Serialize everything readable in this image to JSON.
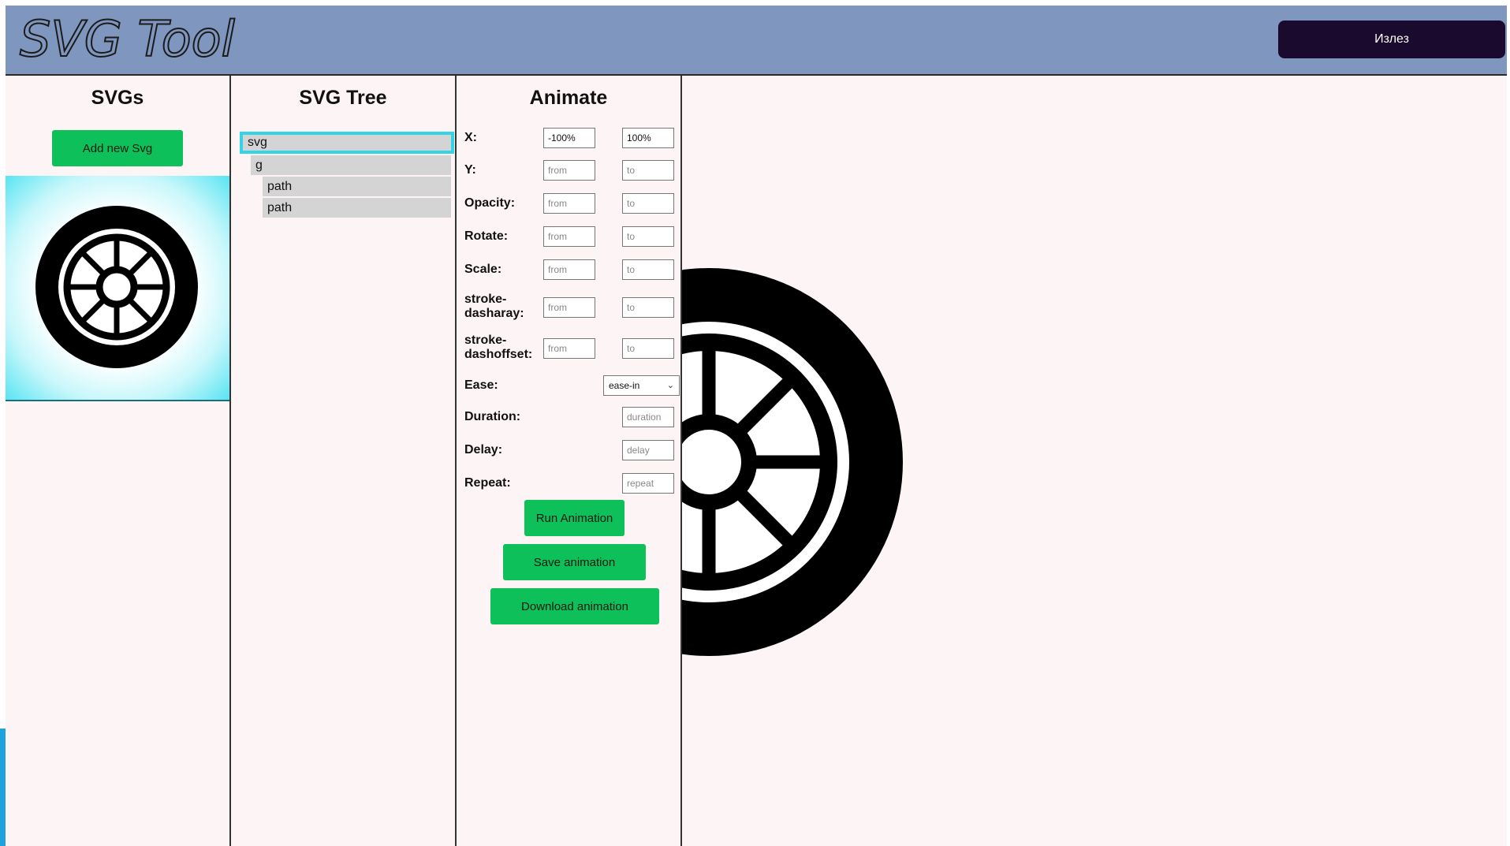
{
  "header": {
    "logo_text": "SVG Tool",
    "logout_label": "Излез"
  },
  "colors": {
    "header_bg": "#7f96be",
    "accent_green": "#0dc05a",
    "logout_bg": "#1a0b2e",
    "selection_cyan": "#34d4e8",
    "page_bg": "#fdf4f6"
  },
  "svgs_panel": {
    "title": "SVGs",
    "add_label": "Add new Svg",
    "items": [
      {
        "icon": "wheel-icon"
      }
    ]
  },
  "tree_panel": {
    "title": "SVG Tree",
    "nodes": [
      {
        "label": "svg",
        "depth": 0,
        "selected": true
      },
      {
        "label": "g",
        "depth": 1,
        "selected": false
      },
      {
        "label": "path",
        "depth": 2,
        "selected": false
      },
      {
        "label": "path",
        "depth": 2,
        "selected": false
      }
    ]
  },
  "animate_panel": {
    "title": "Animate",
    "fields": {
      "x": {
        "label": "X:",
        "from_value": "-100%",
        "to_value": "100%",
        "from_placeholder": "from",
        "to_placeholder": "to"
      },
      "y": {
        "label": "Y:",
        "from_placeholder": "from",
        "to_placeholder": "to"
      },
      "opacity": {
        "label": "Opacity:",
        "from_placeholder": "from",
        "to_placeholder": "to"
      },
      "rotate": {
        "label": "Rotate:",
        "from_placeholder": "from",
        "to_placeholder": "to"
      },
      "scale": {
        "label": "Scale:",
        "from_placeholder": "from",
        "to_placeholder": "to"
      },
      "stroke_dasharay": {
        "label_line1": "stroke-",
        "label_line2": "dasharay:",
        "from_placeholder": "from",
        "to_placeholder": "to"
      },
      "stroke_dashoffset": {
        "label_line1": "stroke-",
        "label_line2": "dashoffset:",
        "from_placeholder": "from",
        "to_placeholder": "to"
      }
    },
    "ease": {
      "label": "Ease:",
      "value": "ease-in"
    },
    "duration": {
      "label": "Duration:",
      "placeholder": "duration"
    },
    "delay": {
      "label": "Delay:",
      "placeholder": "delay"
    },
    "repeat": {
      "label": "Repeat:",
      "placeholder": "repeat"
    },
    "run_label": "Run Animation",
    "save_label": "Save animation",
    "download_label": "Download animation"
  },
  "preview": {
    "icon": "wheel-icon"
  }
}
